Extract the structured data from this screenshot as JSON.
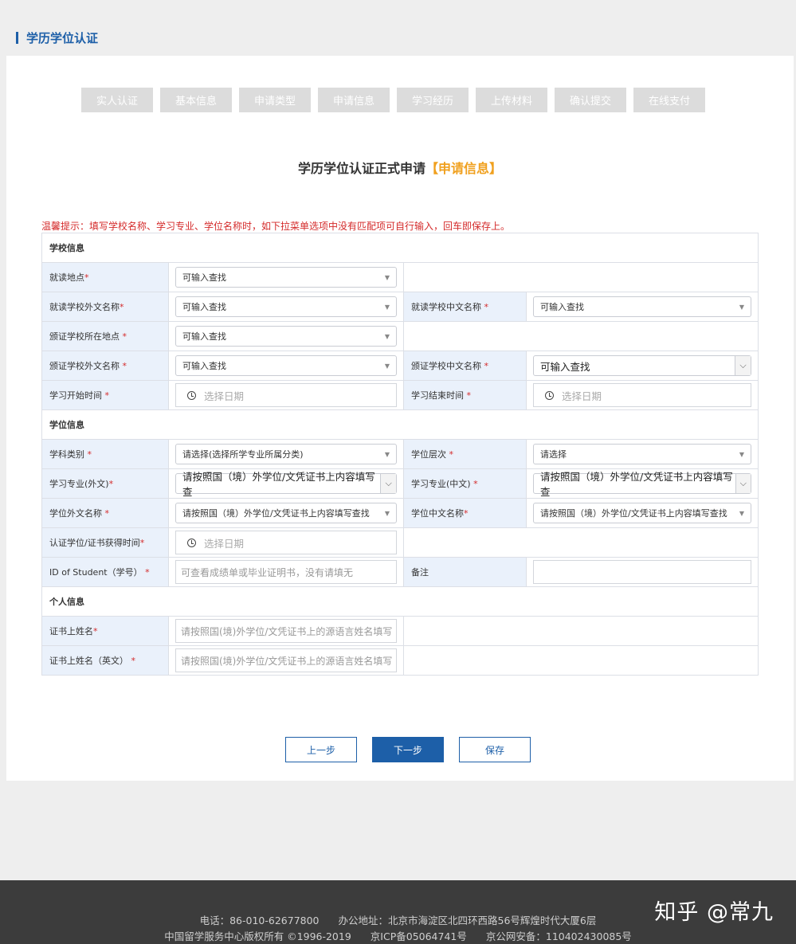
{
  "page_title": "学历学位认证",
  "steps": [
    "实人认证",
    "基本信息",
    "申请类型",
    "申请信息",
    "学习经历",
    "上传材料",
    "确认提交",
    "在线支付"
  ],
  "form_title": {
    "main": "学历学位认证正式申请",
    "highlight": "【申请信息】"
  },
  "tip": "温馨提示：填写学校名称、学习专业、学位名称时，如下拉菜单选项中没有匹配项可自行输入，回车即保存上。",
  "sections": {
    "school": "学校信息",
    "degree": "学位信息",
    "personal": "个人信息"
  },
  "labels": {
    "study_location": "就读地点",
    "school_foreign": "就读学校外文名称",
    "school_cn": "就读学校中文名称 ",
    "issuer_location": "颁证学校所在地点 ",
    "issuer_foreign": "颁证学校外文名称 ",
    "issuer_cn": "颁证学校中文名称 ",
    "start_time": "学习开始时间 ",
    "end_time": "学习结束时间 ",
    "subject": "学科类别 ",
    "degree_level": "学位层次 ",
    "major_foreign": "学习专业(外文)",
    "major_cn": "学习专业(中文) ",
    "degree_foreign": "学位外文名称 ",
    "degree_cn": "学位中文名称",
    "obtained_time": "认证学位/证书获得时间",
    "student_id": "ID of Student（学号） ",
    "remark": "备注",
    "name_cert": "证书上姓名",
    "name_cert_en": "证书上姓名（英文） "
  },
  "values": {
    "searchable": "可输入查找",
    "select_subject": "请选择(选择所学专业所属分类)",
    "select": "请选择",
    "major_hint": "请按照国（境）外学位/文凭证书上内容填写查",
    "degree_hint": "请按照国（境）外学位/文凭证书上内容填写查找",
    "date": "选择日期",
    "student_id_hint": "可查看成绩单或毕业证明书，没有请填无",
    "name_hint": "请按照国(境)外学位/文凭证书上的源语言姓名填写"
  },
  "buttons": {
    "prev": "上一步",
    "next": "下一步",
    "save": "保存"
  },
  "footer": {
    "phone": "电话：86-010-62677800",
    "address": "办公地址：北京市海淀区北四环西路56号辉煌时代大厦6层",
    "copyright": "中国留学服务中心版权所有 ©1996-2019",
    "icp": "京ICP备05064741号",
    "police": "京公网安备：110402430085号"
  },
  "watermark": "知乎 @常九",
  "colors": {
    "brand": "#1d5fa8",
    "highlight": "#f0a01e",
    "required": "#d42a2a"
  }
}
